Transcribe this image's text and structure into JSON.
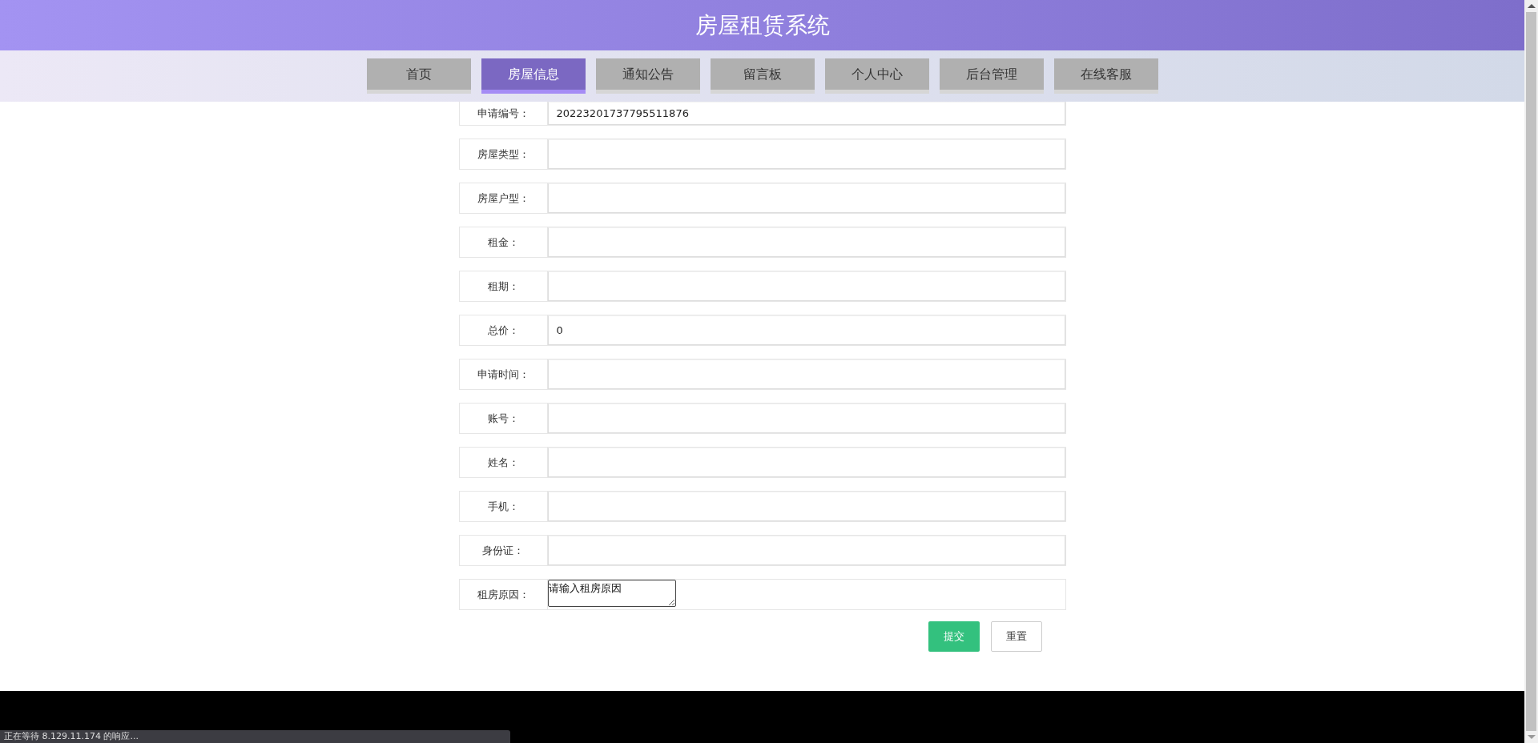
{
  "site_title": "房屋租赁系统",
  "nav": [
    {
      "label": "首页",
      "selected": false
    },
    {
      "label": "房屋信息",
      "selected": true
    },
    {
      "label": "通知公告",
      "selected": false
    },
    {
      "label": "留言板",
      "selected": false
    },
    {
      "label": "个人中心",
      "selected": false
    },
    {
      "label": "后台管理",
      "selected": false
    },
    {
      "label": "在线客服",
      "selected": false
    }
  ],
  "form": {
    "fields": [
      {
        "label": "申请编号：",
        "kind": "input",
        "value": "20223201737795511876"
      },
      {
        "label": "房屋类型：",
        "kind": "input"
      },
      {
        "label": "房屋户型：",
        "kind": "input"
      },
      {
        "label": "租金：",
        "kind": "input"
      },
      {
        "label": "租期：",
        "kind": "input"
      },
      {
        "label": "总价：",
        "kind": "input",
        "value": "0"
      },
      {
        "label": "申请时间：",
        "kind": "input"
      },
      {
        "label": "账号：",
        "kind": "input"
      },
      {
        "label": "姓名：",
        "kind": "input"
      },
      {
        "label": "手机：",
        "kind": "input"
      },
      {
        "label": "身份证：",
        "kind": "input"
      },
      {
        "label": "租房原因：",
        "kind": "textarea",
        "value": "请输入租房原因"
      }
    ],
    "buttons": [
      {
        "label": "提交",
        "kind": "primary"
      },
      {
        "label": "重置",
        "kind": "default"
      }
    ]
  },
  "status_bar": "正在等待 8.129.11.174 的响应..."
}
